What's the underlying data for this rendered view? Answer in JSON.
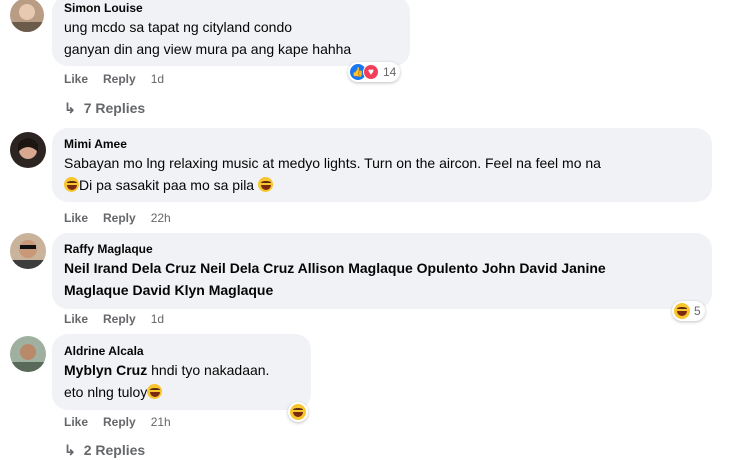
{
  "comments": [
    {
      "name": "Simon Louise",
      "lines": [
        "ung mcdo sa tapat ng cityland condo",
        "ganyan din ang view mura pa ang kape hahha"
      ],
      "like": "Like",
      "reply": "Reply",
      "time": "1d",
      "reaction_count": "14",
      "replies": "7 Replies"
    },
    {
      "name": "Mimi Amee",
      "lines": [
        "Sabayan mo lng relaxing music at medyo lights. Turn on the aircon. Feel na feel mo na",
        "Di pa sasakit paa mo sa pila"
      ],
      "like": "Like",
      "reply": "Reply",
      "time": "22h"
    },
    {
      "name": "Raffy Maglaque",
      "lines": [
        "Neil Irand Dela Cruz Neil Dela Cruz Allison Maglaque Opulento John David Janine",
        "Maglaque David Klyn Maglaque"
      ],
      "like": "Like",
      "reply": "Reply",
      "time": "1d",
      "reaction_count": "5"
    },
    {
      "name": "Aldrine Alcala",
      "tag": "Myblyn Cruz",
      "line1_rest": " hndi tyo nakadaan.",
      "line2": "eto nlng tuloy",
      "like": "Like",
      "reply": "Reply",
      "time": "21h",
      "replies": "2 Replies"
    }
  ],
  "colors": {
    "bubble": "#f0f2f5",
    "secondary_text": "#65676b",
    "like_blue": "#1877f2",
    "love_red": "#f33e58",
    "emoji_yellow": "#f7c52e"
  }
}
